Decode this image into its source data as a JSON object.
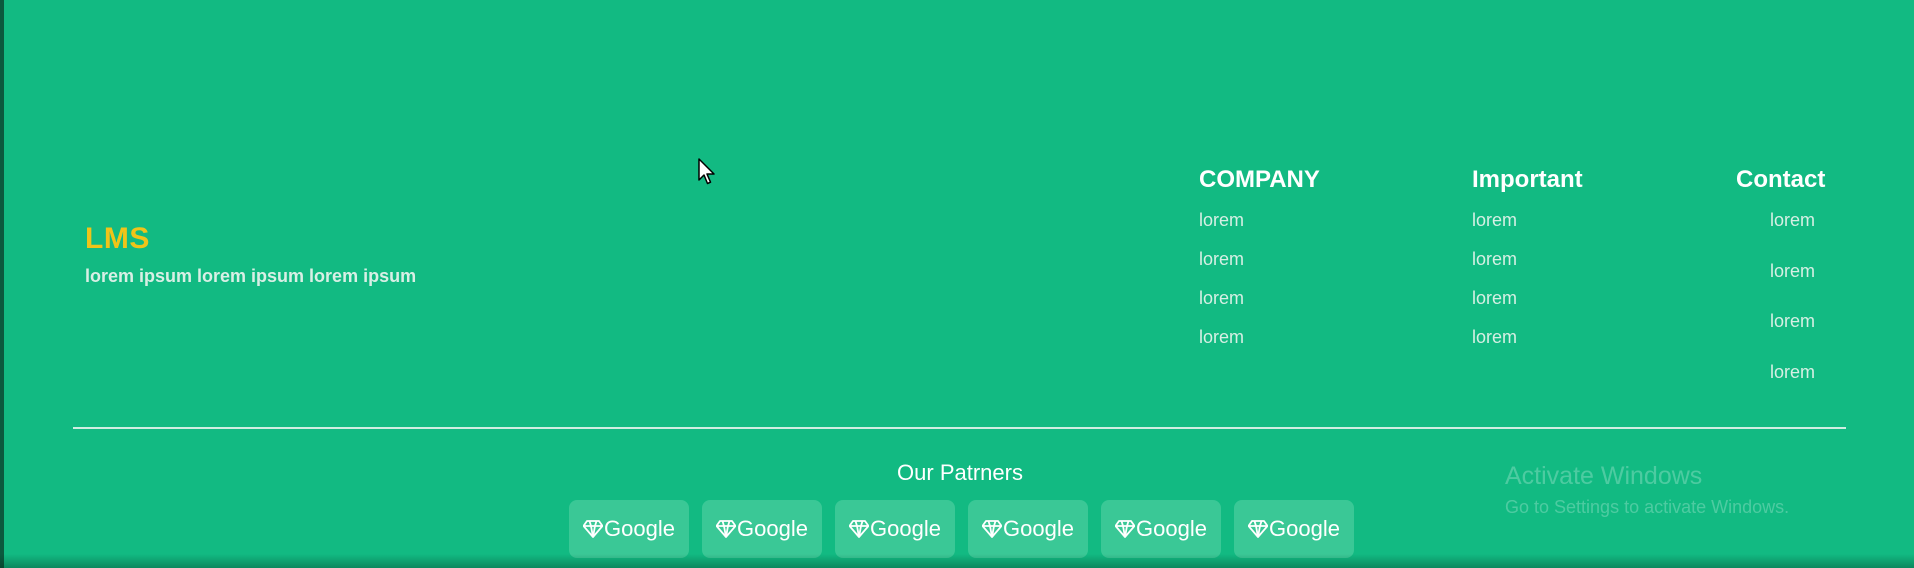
{
  "brand": {
    "title": "LMS",
    "tagline": "lorem ipsum lorem ipsum lorem ipsum"
  },
  "columns": [
    {
      "heading": "COMPANY",
      "links": [
        "lorem",
        "lorem",
        "lorem",
        "lorem"
      ]
    },
    {
      "heading": "Important",
      "links": [
        "lorem",
        "lorem",
        "lorem",
        "lorem"
      ]
    },
    {
      "heading": "Contact",
      "links": [
        "lorem",
        "lorem",
        "lorem",
        "lorem"
      ]
    }
  ],
  "partners": {
    "title": "Our Patrners",
    "items": [
      {
        "label": "Google",
        "icon": "gem-icon"
      },
      {
        "label": "Google",
        "icon": "gem-icon"
      },
      {
        "label": "Google",
        "icon": "gem-icon"
      },
      {
        "label": "Google",
        "icon": "gem-icon"
      },
      {
        "label": "Google",
        "icon": "gem-icon"
      },
      {
        "label": "Google",
        "icon": "gem-icon"
      }
    ]
  },
  "watermark": {
    "title": "Activate Windows",
    "subtitle": "Go to Settings to activate Windows."
  },
  "colors": {
    "background": "#12ba82",
    "brand": "#f0c419",
    "partner_button": "#3ac896"
  }
}
